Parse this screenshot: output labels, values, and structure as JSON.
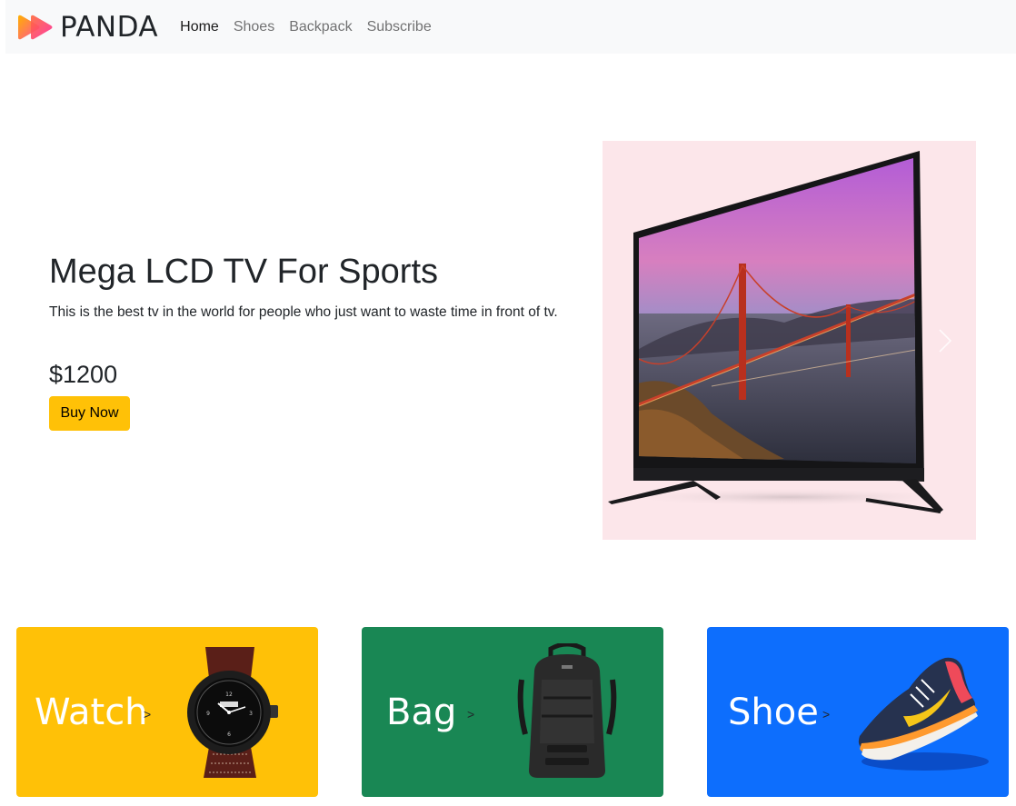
{
  "navbar": {
    "brand": "PANDA",
    "links": [
      {
        "label": "Home",
        "active": true
      },
      {
        "label": "Shoes",
        "active": false
      },
      {
        "label": "Backpack",
        "active": false
      },
      {
        "label": "Subscribe",
        "active": false
      }
    ]
  },
  "hero": {
    "title": "Mega LCD TV For Sports",
    "description": "This is the best tv in the world for people who just want to waste time in front of tv.",
    "price": "$1200",
    "button_label": "Buy Now",
    "image": "lcd-tv-image",
    "next_icon": "chevron-right-icon"
  },
  "categories": [
    {
      "label": "Watch",
      "arrow": ">",
      "image": "watch-image",
      "color": "#ffc107"
    },
    {
      "label": "Bag",
      "arrow": ">",
      "image": "backpack-image",
      "color": "#198754"
    },
    {
      "label": "Shoe",
      "arrow": ">",
      "image": "shoe-image",
      "color": "#0d6efd"
    }
  ],
  "colors": {
    "navbar_bg": "#f8f9fa",
    "accent_yellow": "#ffc107",
    "accent_green": "#198754",
    "accent_blue": "#0d6efd",
    "hero_image_bg": "#fce6ea"
  }
}
